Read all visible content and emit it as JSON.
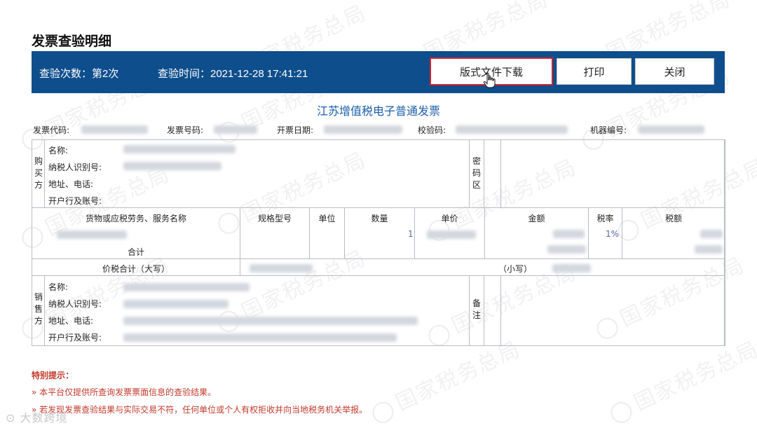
{
  "page": {
    "title": "发票查验明细"
  },
  "watermark": "国家税务总局",
  "bar": {
    "count_label": "查验次数：第2次",
    "time_label": "查验时间：2021-12-28 17:41:21",
    "download_label": "版式文件下载",
    "print_label": "打印",
    "close_label": "关闭",
    "bg_color": "#0f4e8c",
    "highlight_color": "#d8202a"
  },
  "invoice": {
    "title": "江苏增值税电子普通发票",
    "meta": {
      "code_label": "发票代码:",
      "number_label": "发票号码:",
      "date_label": "开票日期:",
      "check_label": "校验码:",
      "machine_label": "机器编号:"
    },
    "buyer": {
      "side_label": "购买方",
      "name_label": "名称:",
      "tax_id_label": "纳税人识别号:",
      "address_label": "地址、电话:",
      "bank_label": "开户行及账号:"
    },
    "cipher_label": "密码区",
    "columns": {
      "goods": "货物或应税劳务、服务名称",
      "spec": "规格型号",
      "unit": "单位",
      "quantity": "数量",
      "price": "单价",
      "amount": "金额",
      "tax_rate": "税率",
      "tax": "税额"
    },
    "line_item": {
      "quantity": "1",
      "tax_rate": "1%"
    },
    "subtotal_label": "合计",
    "total_upper_label": "价税合计（大写）",
    "total_lower_label": "（小写）",
    "seller": {
      "side_label": "销售方",
      "name_label": "名称:",
      "tax_id_label": "纳税人识别号:",
      "address_label": "地址、电话:",
      "bank_label": "开户行及账号:"
    },
    "remarks_label": "备注"
  },
  "tips": {
    "title": "特别提示：",
    "items": [
      "» 本平台仅提供所查询发票票面信息的查验结果。",
      "» 若发现发票查验结果与实际交易不符，任何单位或个人有权拒收并向当地税务机关举报。"
    ]
  },
  "corner_watermark": "大数跨境"
}
